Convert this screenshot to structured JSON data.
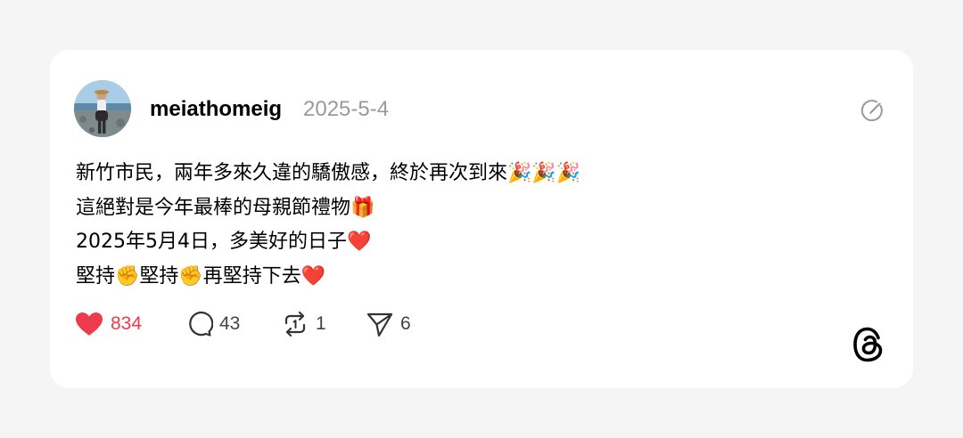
{
  "post": {
    "username": "meiathomeig",
    "date": "2025-5-4",
    "lines": [
      "新竹市民，兩年多來久違的驕傲感，終於再次到來🎉🎉🎉",
      "這絕對是今年最棒的母親節禮物🎁",
      "2025年5月4日，多美好的日子❤️",
      "堅持✊堅持✊再堅持下去❤️"
    ]
  },
  "actions": {
    "likes": "834",
    "comments": "43",
    "reposts": "1",
    "shares": "6"
  },
  "colors": {
    "like_red": "#ee3b4c",
    "muted_gray": "#999999",
    "card_bg": "#ffffff",
    "page_bg": "#f5f5f5"
  },
  "icons": {
    "edit": "edit-icon",
    "like": "heart-icon",
    "comment": "comment-icon",
    "repost": "repost-icon",
    "share": "share-icon",
    "brand": "threads-logo-icon"
  }
}
